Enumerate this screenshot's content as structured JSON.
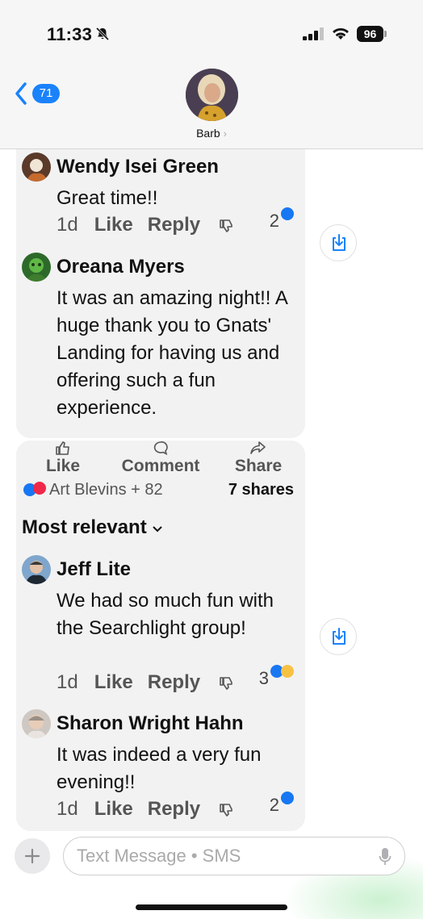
{
  "status_bar": {
    "time": "11:33",
    "battery": "96"
  },
  "header": {
    "back_count": "71",
    "contact_name": "Barb"
  },
  "post1": {
    "comments": [
      {
        "name": "Wendy Isei Green",
        "text": "Great time!!",
        "age": "1d",
        "like": "Like",
        "reply": "Reply",
        "reactions": "2"
      },
      {
        "name": "Oreana Myers",
        "text": "It was an amazing night!! A huge thank you to Gnats' Landing for having us and offering such a fun experience."
      }
    ]
  },
  "post2": {
    "actions": {
      "like": "Like",
      "comment": "Comment",
      "share": "Share"
    },
    "reactors": "Art Blevins + 82",
    "shares": "7 shares",
    "sort": "Most relevant",
    "comments": [
      {
        "name": "Jeff Lite",
        "text": "We had so much fun with the Searchlight group!",
        "age": "1d",
        "like": "Like",
        "reply": "Reply",
        "reactions": "3"
      },
      {
        "name": "Sharon Wright Hahn",
        "text": "It was indeed a very fun evening!!",
        "age": "1d",
        "like": "Like",
        "reply": "Reply",
        "reactions": "2"
      }
    ]
  },
  "composer": {
    "placeholder": "Text Message • SMS"
  },
  "colors": {
    "accent": "#1a82fb",
    "bubble": "#f2f2f2",
    "like_blue": "#1877f2"
  }
}
